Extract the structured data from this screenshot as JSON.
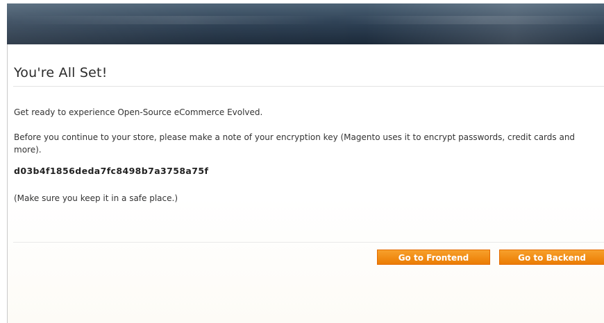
{
  "header": {
    "colors": {
      "top": "#4c6275",
      "bottom": "#1c2a3a"
    }
  },
  "main": {
    "title": "You're All Set!",
    "intro": "Get ready to experience Open-Source eCommerce Evolved.",
    "note": "Before you continue to your store, please make a note of your encryption key (Magento uses it to encrypt passwords, credit cards and more).",
    "encryption_key": "d03b4f1856deda7fc8498b7a3758a75f",
    "safe_note": "(Make sure you keep it in a safe place.)"
  },
  "actions": {
    "frontend_label": "Go to Frontend",
    "backend_label": "Go to Backend",
    "button_color": "#f08a12"
  }
}
